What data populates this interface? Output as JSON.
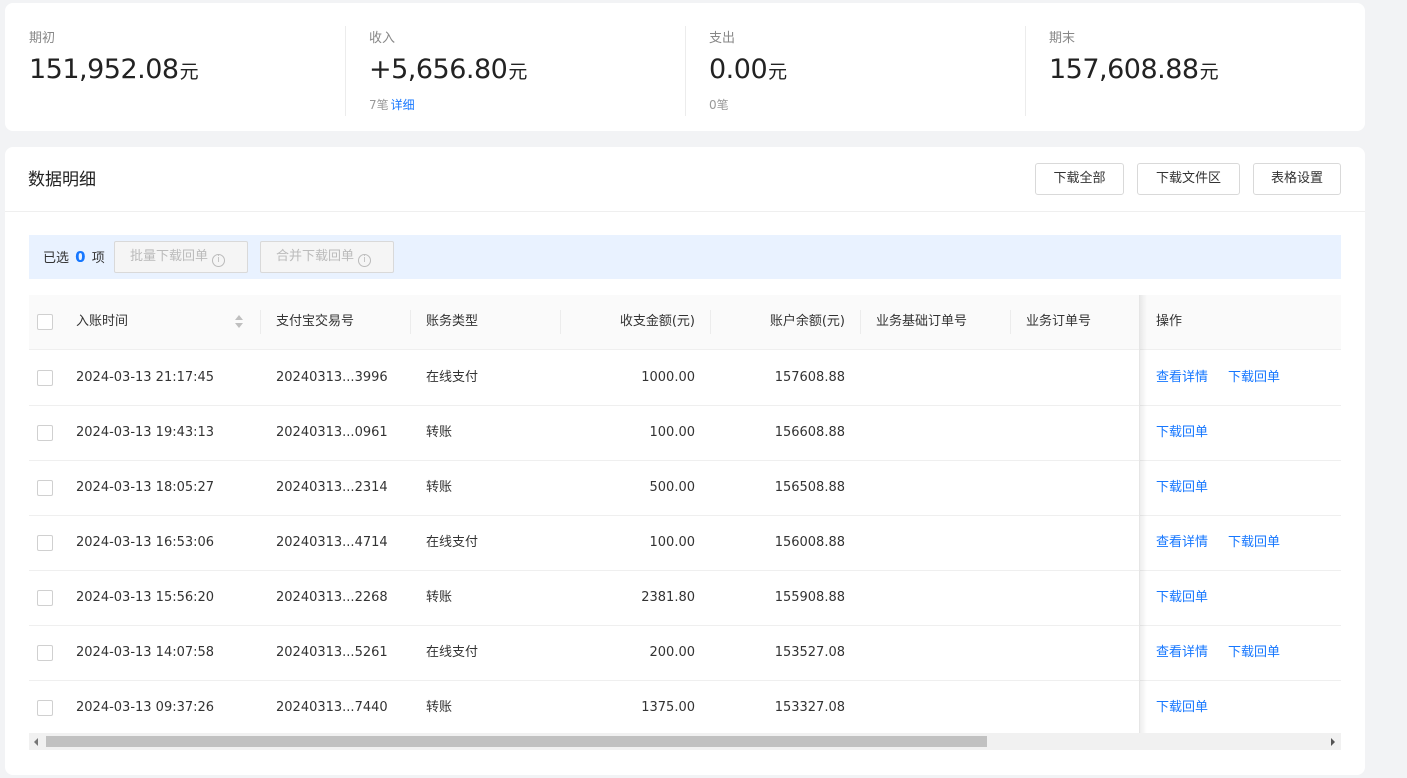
{
  "summary": {
    "opening": {
      "label": "期初",
      "value": "151,952.08",
      "unit": "元"
    },
    "income": {
      "label": "收入",
      "value": "+5,656.80",
      "unit": "元",
      "count": "7笔",
      "detail_link": "详细"
    },
    "expense": {
      "label": "支出",
      "value": "0.00",
      "unit": "元",
      "count": "0笔"
    },
    "closing": {
      "label": "期末",
      "value": "157,608.88",
      "unit": "元"
    }
  },
  "detail": {
    "title": "数据明细",
    "buttons": {
      "download_all": "下载全部",
      "download_area": "下载文件区",
      "table_settings": "表格设置"
    }
  },
  "selection": {
    "prefix": "已选",
    "count": "0",
    "suffix": "项",
    "batch_download": "批量下载回单",
    "merge_download": "合并下载回单",
    "info_icon": "i"
  },
  "table": {
    "columns": [
      "入账时间",
      "支付宝交易号",
      "账务类型",
      "收支金额(元)",
      "账户余额(元)",
      "业务基础订单号",
      "业务订单号",
      "操作"
    ],
    "rows": [
      {
        "time": "2024-03-13 21:17:45",
        "trade_no": "20240313...3996",
        "type": "在线支付",
        "amount": "1000.00",
        "balance": "157608.88",
        "base_order": "",
        "order": "",
        "actions": [
          "查看详情",
          "下载回单"
        ]
      },
      {
        "time": "2024-03-13 19:43:13",
        "trade_no": "20240313...0961",
        "type": "转账",
        "amount": "100.00",
        "balance": "156608.88",
        "base_order": "",
        "order": "",
        "actions": [
          "下载回单"
        ]
      },
      {
        "time": "2024-03-13 18:05:27",
        "trade_no": "20240313...2314",
        "type": "转账",
        "amount": "500.00",
        "balance": "156508.88",
        "base_order": "",
        "order": "",
        "actions": [
          "下载回单"
        ]
      },
      {
        "time": "2024-03-13 16:53:06",
        "trade_no": "20240313...4714",
        "type": "在线支付",
        "amount": "100.00",
        "balance": "156008.88",
        "base_order": "",
        "order": "",
        "actions": [
          "查看详情",
          "下载回单"
        ]
      },
      {
        "time": "2024-03-13 15:56:20",
        "trade_no": "20240313...2268",
        "type": "转账",
        "amount": "2381.80",
        "balance": "155908.88",
        "base_order": "",
        "order": "",
        "actions": [
          "下载回单"
        ]
      },
      {
        "time": "2024-03-13 14:07:58",
        "trade_no": "20240313...5261",
        "type": "在线支付",
        "amount": "200.00",
        "balance": "153527.08",
        "base_order": "",
        "order": "",
        "actions": [
          "查看详情",
          "下载回单"
        ]
      },
      {
        "time": "2024-03-13 09:37:26",
        "trade_no": "20240313...7440",
        "type": "转账",
        "amount": "1375.00",
        "balance": "153327.08",
        "base_order": "",
        "order": "",
        "actions": [
          "下载回单"
        ]
      }
    ]
  },
  "colors": {
    "accent": "#1677ff",
    "select_bar_bg": "#e9f2ff"
  }
}
